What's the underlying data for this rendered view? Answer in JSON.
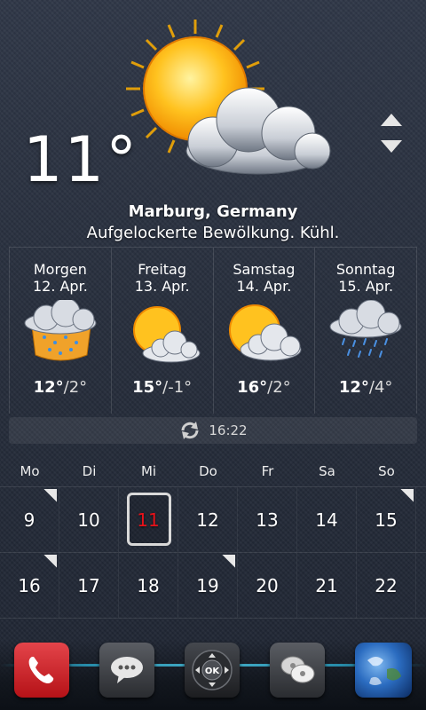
{
  "current": {
    "temperature": "11°",
    "city": "Marburg, Germany",
    "condition": "Aufgelockerte Bewölkung. Kühl.",
    "icon": "partly-cloudy-sun-icon"
  },
  "forecast": [
    {
      "day": "Morgen",
      "date": "12. Apr.",
      "high": "12°",
      "low": "/2°",
      "icon": "rain-cloud-icon"
    },
    {
      "day": "Freitag",
      "date": "13. Apr.",
      "high": "15°",
      "low": "/-1°",
      "icon": "sun-cloud-icon"
    },
    {
      "day": "Samstag",
      "date": "14. Apr.",
      "high": "16°",
      "low": "/2°",
      "icon": "sun-cloud-icon"
    },
    {
      "day": "Sonntag",
      "date": "15. Apr.",
      "high": "12°",
      "low": "/4°",
      "icon": "rain-cloud-icon"
    }
  ],
  "refresh": {
    "time": "16:22",
    "icon": "refresh-icon"
  },
  "calendar": {
    "weekdays": [
      "Mo",
      "Di",
      "Mi",
      "Do",
      "Fr",
      "Sa",
      "So"
    ],
    "weeks": [
      [
        "9",
        "10",
        "11",
        "12",
        "13",
        "14",
        "15"
      ],
      [
        "16",
        "17",
        "18",
        "19",
        "20",
        "21",
        "22"
      ]
    ],
    "today": "11",
    "today_color": "#e8121a"
  },
  "dock": [
    "phone-icon",
    "sms-icon",
    "navigation-ok-icon",
    "chat-icon",
    "earth-icon"
  ],
  "colors": {
    "accent_dock_line": "#4fd1f0",
    "phone_red": "#d6262c"
  }
}
